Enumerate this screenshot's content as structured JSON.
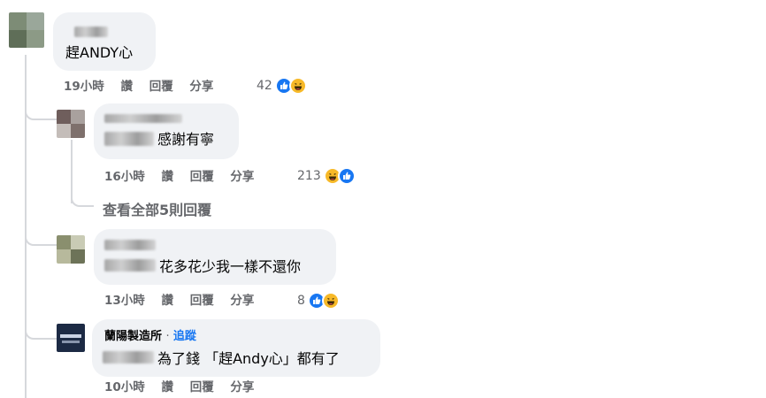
{
  "comments": [
    {
      "text": "趕ANDY心",
      "time": "19小時",
      "like": "讚",
      "reply": "回覆",
      "share": "分享",
      "reaction_count": "42"
    },
    {
      "text": "感謝有寧",
      "time": "16小時",
      "like": "讚",
      "reply": "回覆",
      "share": "分享",
      "reaction_count": "213"
    },
    {
      "text": "花多花少我一樣不還你",
      "time": "13小時",
      "like": "讚",
      "reply": "回覆",
      "share": "分享",
      "reaction_count": "8"
    },
    {
      "author": "蘭陽製造所",
      "separator": "·",
      "follow": "追蹤",
      "text": "為了錢 「趕Andy心」都有了",
      "time": "10小時",
      "like": "讚",
      "reply": "回覆",
      "share": "分享"
    }
  ],
  "view_all_replies": "查看全部5則回覆",
  "colors": {
    "like": "#1877f2",
    "haha": "#f7b928",
    "bubble": "#f0f2f5",
    "meta": "#65676b",
    "link": "#1877f2"
  },
  "icons": [
    "like-reaction-icon",
    "haha-reaction-icon"
  ]
}
